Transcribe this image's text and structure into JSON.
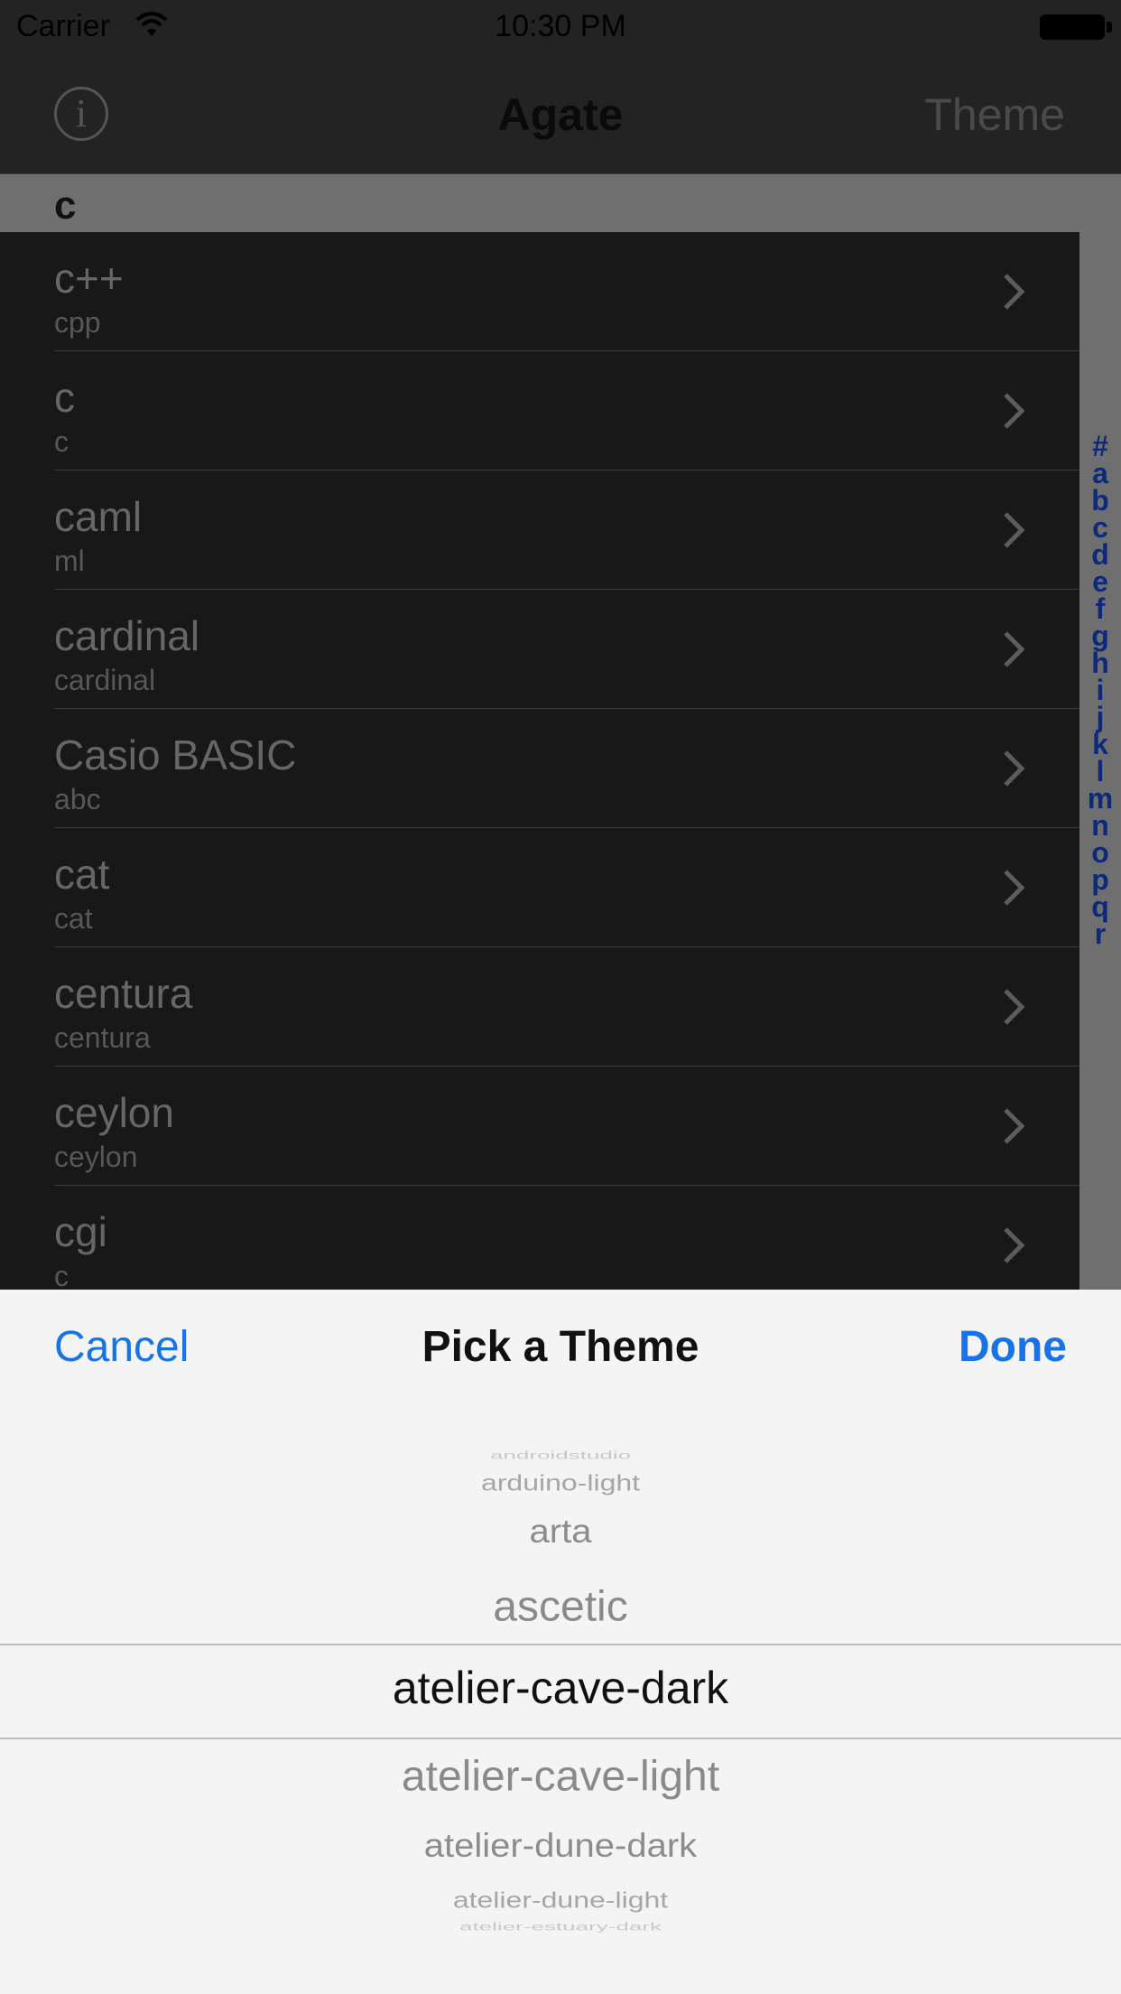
{
  "status_bar": {
    "carrier": "Carrier",
    "time": "10:30 PM"
  },
  "nav": {
    "title": "Agate",
    "right_button": "Theme",
    "info_glyph": "i"
  },
  "section": {
    "header": "c"
  },
  "index": [
    "#",
    "a",
    "b",
    "c",
    "d",
    "e",
    "f",
    "g",
    "h",
    "i",
    "j",
    "k",
    "l",
    "m",
    "n",
    "o",
    "p",
    "q",
    "r"
  ],
  "rows": [
    {
      "name": "c++",
      "sub": "cpp"
    },
    {
      "name": "c",
      "sub": "c"
    },
    {
      "name": "caml",
      "sub": "ml"
    },
    {
      "name": "cardinal",
      "sub": "cardinal"
    },
    {
      "name": "Casio BASIC",
      "sub": "abc"
    },
    {
      "name": "cat",
      "sub": "cat"
    },
    {
      "name": "centura",
      "sub": "centura"
    },
    {
      "name": "ceylon",
      "sub": "ceylon"
    },
    {
      "name": "cgi",
      "sub": "c"
    }
  ],
  "sheet": {
    "cancel": "Cancel",
    "title": "Pick a Theme",
    "done": "Done",
    "picker_items": [
      "androidstudio",
      "arduino-light",
      "arta",
      "ascetic",
      "atelier-cave-dark",
      "atelier-cave-light",
      "atelier-dune-dark",
      "atelier-dune-light",
      "atelier-estuary-dark"
    ],
    "selected": "atelier-cave-dark"
  },
  "colors": {
    "accent": "#1873e6",
    "index_text": "#0d2a7a",
    "sheet_bg": "#f4f4f5",
    "list_bg": "#181818"
  }
}
